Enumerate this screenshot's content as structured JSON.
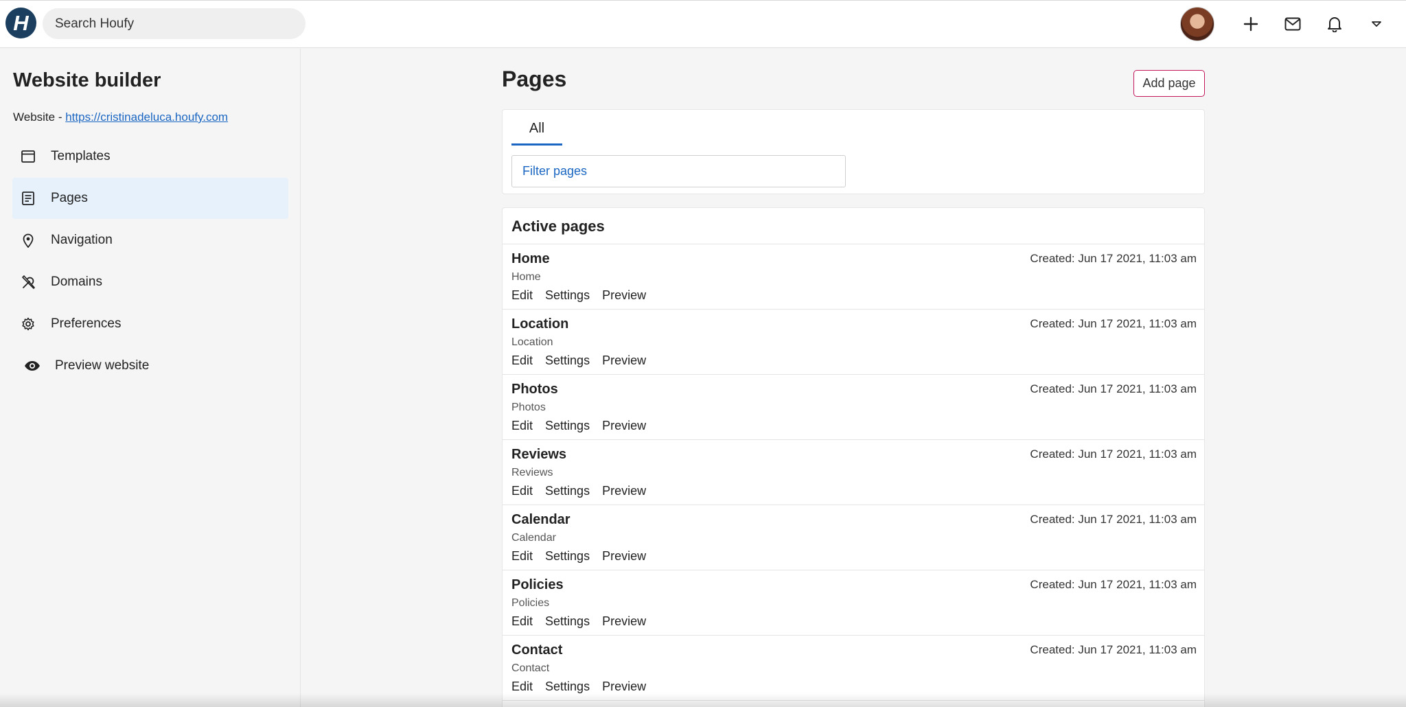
{
  "topbar": {
    "logo_letter": "H",
    "search_placeholder": "Search Houfy",
    "icons": [
      "plus-icon",
      "mail-icon",
      "bell-icon",
      "chevron-down-icon"
    ]
  },
  "sidebar": {
    "title": "Website builder",
    "website_label": "Website - ",
    "website_url": "https://cristinadeluca.houfy.com",
    "items": [
      {
        "label": "Templates",
        "icon": "browser-window-icon"
      },
      {
        "label": "Pages",
        "icon": "document-icon",
        "active": true
      },
      {
        "label": "Navigation",
        "icon": "map-pin-icon"
      },
      {
        "label": "Domains",
        "icon": "tools-icon"
      },
      {
        "label": "Preferences",
        "icon": "gear-icon"
      },
      {
        "label": "Preview website",
        "icon": "eye-icon"
      }
    ]
  },
  "main": {
    "title": "Pages",
    "add_button": "Add page",
    "tabs": [
      {
        "label": "All",
        "active": true
      }
    ],
    "filter_placeholder": "Filter pages",
    "active_title": "Active pages",
    "actions": [
      "Edit",
      "Settings",
      "Preview"
    ],
    "pages": [
      {
        "name": "Home",
        "sub": "Home",
        "created": "Created: Jun 17 2021, 11:03 am"
      },
      {
        "name": "Location",
        "sub": "Location",
        "created": "Created: Jun 17 2021, 11:03 am"
      },
      {
        "name": "Photos",
        "sub": "Photos",
        "created": "Created: Jun 17 2021, 11:03 am"
      },
      {
        "name": "Reviews",
        "sub": "Reviews",
        "created": "Created: Jun 17 2021, 11:03 am"
      },
      {
        "name": "Calendar",
        "sub": "Calendar",
        "created": "Created: Jun 17 2021, 11:03 am"
      },
      {
        "name": "Policies",
        "sub": "Policies",
        "created": "Created: Jun 17 2021, 11:03 am"
      },
      {
        "name": "Contact",
        "sub": "Contact",
        "created": "Created: Jun 17 2021, 11:03 am"
      }
    ]
  },
  "colors": {
    "accent": "#1a66c2",
    "add_button_border": "#c2185b",
    "logo_bg": "#1c3f60",
    "active_item_bg": "#e6f1fc"
  }
}
